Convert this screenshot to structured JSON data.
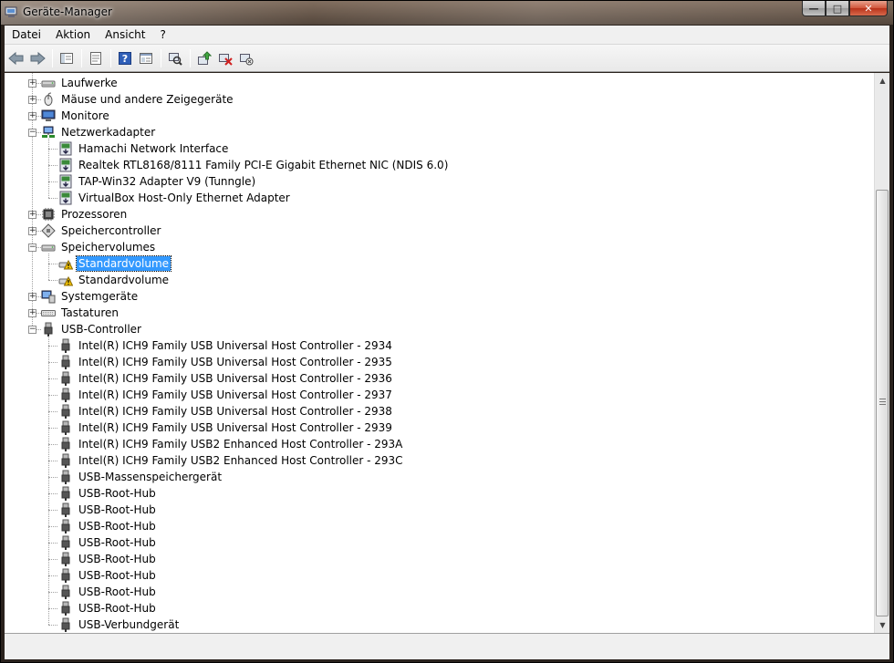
{
  "window": {
    "title": "Geräte-Manager",
    "caption": {
      "minimize": "—",
      "maximize": "□",
      "close": "✕"
    }
  },
  "menu": [
    "Datei",
    "Aktion",
    "Ansicht",
    "?"
  ],
  "toolbar": [
    "back-icon",
    "forward-icon",
    "show-hide-tree-icon",
    "properties-icon",
    "help-icon",
    "view-icon",
    "scan-hardware-icon",
    "update-driver-icon",
    "uninstall-icon",
    "disable-device-icon"
  ],
  "tree": [
    {
      "label": "Laufwerke",
      "level": 0,
      "expander": "+",
      "icon": "drive-icon"
    },
    {
      "label": "Mäuse und andere Zeigegeräte",
      "level": 0,
      "expander": "+",
      "icon": "mouse-icon"
    },
    {
      "label": "Monitore",
      "level": 0,
      "expander": "+",
      "icon": "monitor-icon"
    },
    {
      "label": "Netzwerkadapter",
      "level": 0,
      "expander": "-",
      "icon": "network-icon"
    },
    {
      "label": "Hamachi Network Interface",
      "level": 1,
      "icon": "network-adapter-icon"
    },
    {
      "label": "Realtek RTL8168/8111 Family PCI-E Gigabit Ethernet NIC (NDIS 6.0)",
      "level": 1,
      "icon": "network-adapter-icon"
    },
    {
      "label": "TAP-Win32 Adapter V9 (Tunngle)",
      "level": 1,
      "icon": "network-adapter-icon"
    },
    {
      "label": "VirtualBox Host-Only Ethernet Adapter",
      "level": 1,
      "icon": "network-adapter-icon"
    },
    {
      "label": "Prozessoren",
      "level": 0,
      "expander": "+",
      "icon": "processor-icon"
    },
    {
      "label": "Speichercontroller",
      "level": 0,
      "expander": "+",
      "icon": "storage-controller-icon"
    },
    {
      "label": "Speichervolumes",
      "level": 0,
      "expander": "-",
      "icon": "drive-icon"
    },
    {
      "label": "Standardvolume",
      "level": 1,
      "icon": "volume-warning-icon",
      "selected": true
    },
    {
      "label": "Standardvolume",
      "level": 1,
      "icon": "volume-warning-icon"
    },
    {
      "label": "Systemgeräte",
      "level": 0,
      "expander": "+",
      "icon": "system-icon"
    },
    {
      "label": "Tastaturen",
      "level": 0,
      "expander": "+",
      "icon": "keyboard-icon"
    },
    {
      "label": "USB-Controller",
      "level": 0,
      "expander": "-",
      "icon": "usb-icon"
    },
    {
      "label": "Intel(R) ICH9 Family USB Universal Host Controller - 2934",
      "level": 1,
      "icon": "usb-icon"
    },
    {
      "label": "Intel(R) ICH9 Family USB Universal Host Controller - 2935",
      "level": 1,
      "icon": "usb-icon"
    },
    {
      "label": "Intel(R) ICH9 Family USB Universal Host Controller - 2936",
      "level": 1,
      "icon": "usb-icon"
    },
    {
      "label": "Intel(R) ICH9 Family USB Universal Host Controller - 2937",
      "level": 1,
      "icon": "usb-icon"
    },
    {
      "label": "Intel(R) ICH9 Family USB Universal Host Controller - 2938",
      "level": 1,
      "icon": "usb-icon"
    },
    {
      "label": "Intel(R) ICH9 Family USB Universal Host Controller - 2939",
      "level": 1,
      "icon": "usb-icon"
    },
    {
      "label": "Intel(R) ICH9 Family USB2 Enhanced Host Controller - 293A",
      "level": 1,
      "icon": "usb-icon"
    },
    {
      "label": "Intel(R) ICH9 Family USB2 Enhanced Host Controller - 293C",
      "level": 1,
      "icon": "usb-icon"
    },
    {
      "label": "USB-Massenspeichergerät",
      "level": 1,
      "icon": "usb-icon"
    },
    {
      "label": "USB-Root-Hub",
      "level": 1,
      "icon": "usb-icon"
    },
    {
      "label": "USB-Root-Hub",
      "level": 1,
      "icon": "usb-icon"
    },
    {
      "label": "USB-Root-Hub",
      "level": 1,
      "icon": "usb-icon"
    },
    {
      "label": "USB-Root-Hub",
      "level": 1,
      "icon": "usb-icon"
    },
    {
      "label": "USB-Root-Hub",
      "level": 1,
      "icon": "usb-icon"
    },
    {
      "label": "USB-Root-Hub",
      "level": 1,
      "icon": "usb-icon"
    },
    {
      "label": "USB-Root-Hub",
      "level": 1,
      "icon": "usb-icon"
    },
    {
      "label": "USB-Root-Hub",
      "level": 1,
      "icon": "usb-icon"
    },
    {
      "label": "USB-Verbundgerät",
      "level": 1,
      "icon": "usb-icon"
    }
  ],
  "colors": {
    "selection": "#3399ff",
    "titlebar": "#5a4a3e",
    "chrome": "#f0f0f0"
  }
}
